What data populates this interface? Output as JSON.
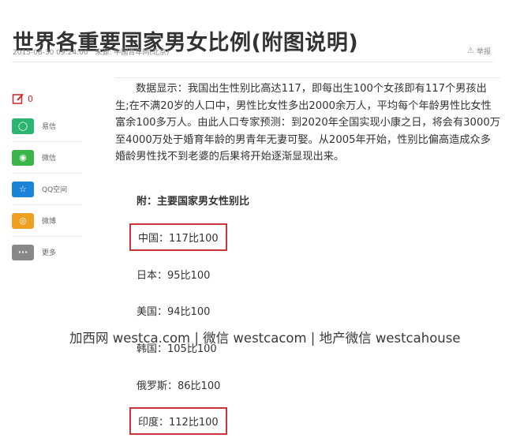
{
  "article": {
    "title": "世界各重要国家男女比例(附图说明)",
    "date": "2015-08-30 09:24:00",
    "source": "来源: 中国青年网(北京)",
    "report_label": "举报",
    "body": "数据显示：我国出生性别比高达117，即每出生100个女孩即有117个男孩出生;在不满20岁的人口中，男性比女性多出2000余万人，平均每个年龄男性比女性富余100多万人。由此人口专家预测：到2020年全国实现小康之日，将会有3000万至4000万处于婚育年龄的男青年无妻可娶。从2005年开始，性别比偏高造成众多婚龄男性找不到老婆的后果将开始逐渐显现出来。",
    "table_heading": "附：主要国家男女性别比",
    "rows": [
      {
        "text": "中国：117比100",
        "highlighted": true
      },
      {
        "text": "日本：95比100",
        "highlighted": false
      },
      {
        "text": "美国：94比100",
        "highlighted": false
      },
      {
        "text": "韩国：105比100",
        "highlighted": false
      },
      {
        "text": "俄罗斯：86比100",
        "highlighted": false
      },
      {
        "text": "印度：112比100",
        "highlighted": true
      }
    ]
  },
  "share": {
    "comment_count": "0",
    "items": [
      {
        "label": "易信",
        "icon": "yixin-icon",
        "color": "#2bb573"
      },
      {
        "label": "微信",
        "icon": "wechat-icon",
        "color": "#3ab54a"
      },
      {
        "label": "QQ空间",
        "icon": "qzone-icon",
        "color": "#1b84d6"
      },
      {
        "label": "微博",
        "icon": "weibo-icon",
        "color": "#f0a020"
      },
      {
        "label": "更多",
        "icon": "more-icon",
        "color": "#888888"
      }
    ]
  },
  "watermark": "加西网 westca.com | 微信 westcacom | 地产微信 westcahouse",
  "colors": {
    "highlight_box": "#c8363c",
    "comment_icon": "#d22222"
  }
}
